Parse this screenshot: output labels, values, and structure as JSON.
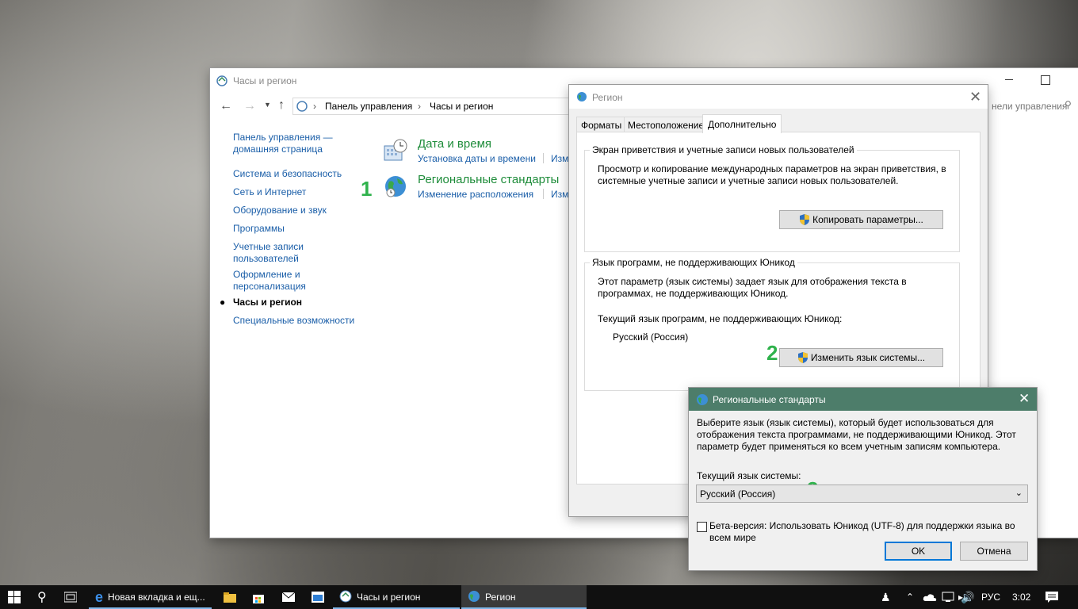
{
  "control_panel": {
    "title": "Часы и регион",
    "breadcrumb": [
      "Панель управления",
      "Часы и регион"
    ],
    "search_placeholder": "Поиск в панели управления",
    "search_visible": "нели управления",
    "sidebar": {
      "home": "Панель управления — домашняя страница",
      "items": [
        "Система и безопасность",
        "Сеть и Интернет",
        "Оборудование и звук",
        "Программы",
        "Учетные записи пользователей",
        "Оформление и персонализация",
        "Часы и регион",
        "Специальные возможности"
      ],
      "active_index": 6
    },
    "sections": [
      {
        "title": "Дата и время",
        "links": [
          "Установка даты и времени",
          "Изм"
        ]
      },
      {
        "title": "Региональные стандарты",
        "links": [
          "Изменение расположения",
          "Изм"
        ]
      }
    ],
    "marker": "1"
  },
  "region_dialog": {
    "title": "Регион",
    "tabs": [
      "Форматы",
      "Местоположение",
      "Дополнительно"
    ],
    "active_tab": 2,
    "welcome_group": {
      "title": "Экран приветствия и учетные записи новых пользователей",
      "text": "Просмотр и копирование международных параметров на экран приветствия, в системные учетные записи и учетные записи новых пользователей.",
      "button": "Копировать параметры..."
    },
    "unicode_group": {
      "title": "Язык программ, не поддерживающих Юникод",
      "text": "Этот параметр (язык системы) задает язык для отображения текста в программах, не поддерживающих Юникод.",
      "current_label": "Текущий язык программ, не поддерживающих Юникод:",
      "current_value": "Русский (Россия)",
      "button": "Изменить язык системы..."
    },
    "marker": "2"
  },
  "regional_dialog": {
    "title": "Региональные стандарты",
    "description": "Выберите язык (язык системы), который будет использоваться для отображения текста программами, не поддерживающими Юникод. Этот параметр будет применяться ко всем учетным записям компьютера.",
    "current_label": "Текущий язык системы:",
    "select_value": "Русский (Россия)",
    "checkbox_label": "Бета-версия: Использовать Юникод (UTF-8) для поддержки языка во всем мире",
    "checkbox_checked": false,
    "ok": "OK",
    "cancel": "Отмена",
    "marker": "3"
  },
  "taskbar": {
    "apps": [
      {
        "label": "Новая вкладка и ещ...",
        "icon": "edge-icon"
      },
      {
        "label": "Часы и регион",
        "icon": "control-panel-icon"
      },
      {
        "label": "Регион",
        "icon": "globe-icon"
      }
    ],
    "language": "РУС",
    "time": "3:02"
  }
}
